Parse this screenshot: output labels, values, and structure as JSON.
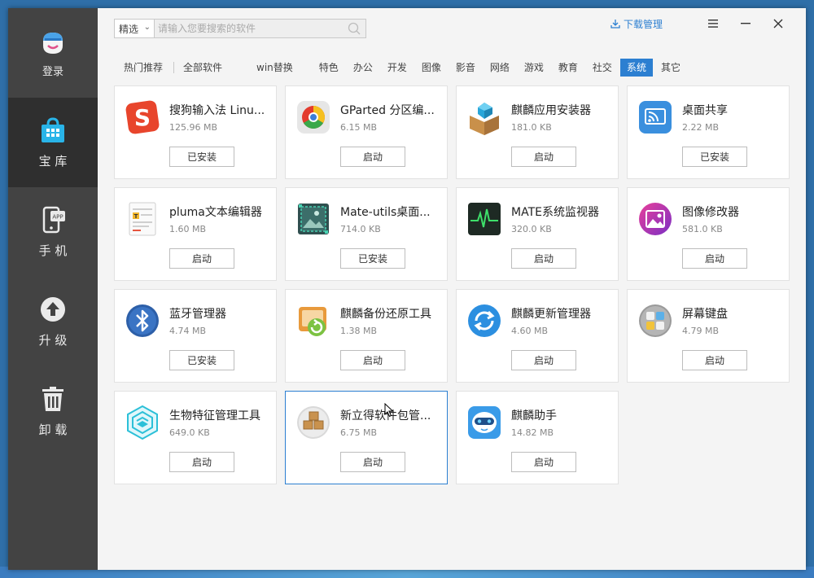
{
  "sidebar": {
    "items": [
      {
        "label": "登录",
        "icon": "user-avatar-icon"
      },
      {
        "label": "宝 库",
        "icon": "shopping-bag-icon"
      },
      {
        "label": "手 机",
        "icon": "phone-app-icon"
      },
      {
        "label": "升 级",
        "icon": "upgrade-arrow-icon"
      },
      {
        "label": "卸 载",
        "icon": "trash-icon"
      }
    ]
  },
  "search": {
    "filter_value": "精选",
    "placeholder": "请输入您要搜索的软件"
  },
  "header": {
    "download_manager": "下载管理"
  },
  "tabs": [
    "热门推荐",
    "全部软件",
    "win替换",
    "特色",
    "办公",
    "开发",
    "图像",
    "影音",
    "网络",
    "游戏",
    "教育",
    "社交",
    "系统",
    "其它"
  ],
  "active_tab": "系统",
  "apps": [
    {
      "name": "搜狗输入法 Linu...",
      "size": "125.96 MB",
      "button": "已安装",
      "icon": "sogou-icon"
    },
    {
      "name": "GParted 分区编...",
      "size": "6.15 MB",
      "button": "启动",
      "icon": "gparted-icon"
    },
    {
      "name": "麒麟应用安装器",
      "size": "181.0 KB",
      "button": "启动",
      "icon": "package-box-icon"
    },
    {
      "name": "桌面共享",
      "size": "2.22 MB",
      "button": "已安装",
      "icon": "desktop-share-icon"
    },
    {
      "name": "pluma文本编辑器",
      "size": "1.60 MB",
      "button": "启动",
      "icon": "text-editor-icon"
    },
    {
      "name": "Mate-utils桌面...",
      "size": "714.0 KB",
      "button": "已安装",
      "icon": "screenshot-icon"
    },
    {
      "name": "MATE系统监视器",
      "size": "320.0 KB",
      "button": "启动",
      "icon": "system-monitor-icon"
    },
    {
      "name": "图像修改器",
      "size": "581.0 KB",
      "button": "启动",
      "icon": "image-editor-icon"
    },
    {
      "name": "蓝牙管理器",
      "size": "4.74 MB",
      "button": "已安装",
      "icon": "bluetooth-icon"
    },
    {
      "name": "麒麟备份还原工具",
      "size": "1.38 MB",
      "button": "启动",
      "icon": "backup-restore-icon"
    },
    {
      "name": "麒麟更新管理器",
      "size": "4.60 MB",
      "button": "启动",
      "icon": "update-manager-icon"
    },
    {
      "name": "屏幕键盘",
      "size": "4.79 MB",
      "button": "启动",
      "icon": "onscreen-keyboard-icon"
    },
    {
      "name": "生物特征管理工具",
      "size": "649.0 KB",
      "button": "启动",
      "icon": "biometric-icon"
    },
    {
      "name": "新立得软件包管...",
      "size": "6.75 MB",
      "button": "启动",
      "icon": "synaptic-icon"
    },
    {
      "name": "麒麟助手",
      "size": "14.82 MB",
      "button": "启动",
      "icon": "kylin-assistant-icon"
    }
  ],
  "selected_app_index": 13,
  "colors": {
    "accent": "#2c7fd1",
    "sidebar_bg": "#434343",
    "sidebar_active_bg": "#2f2f2f"
  }
}
